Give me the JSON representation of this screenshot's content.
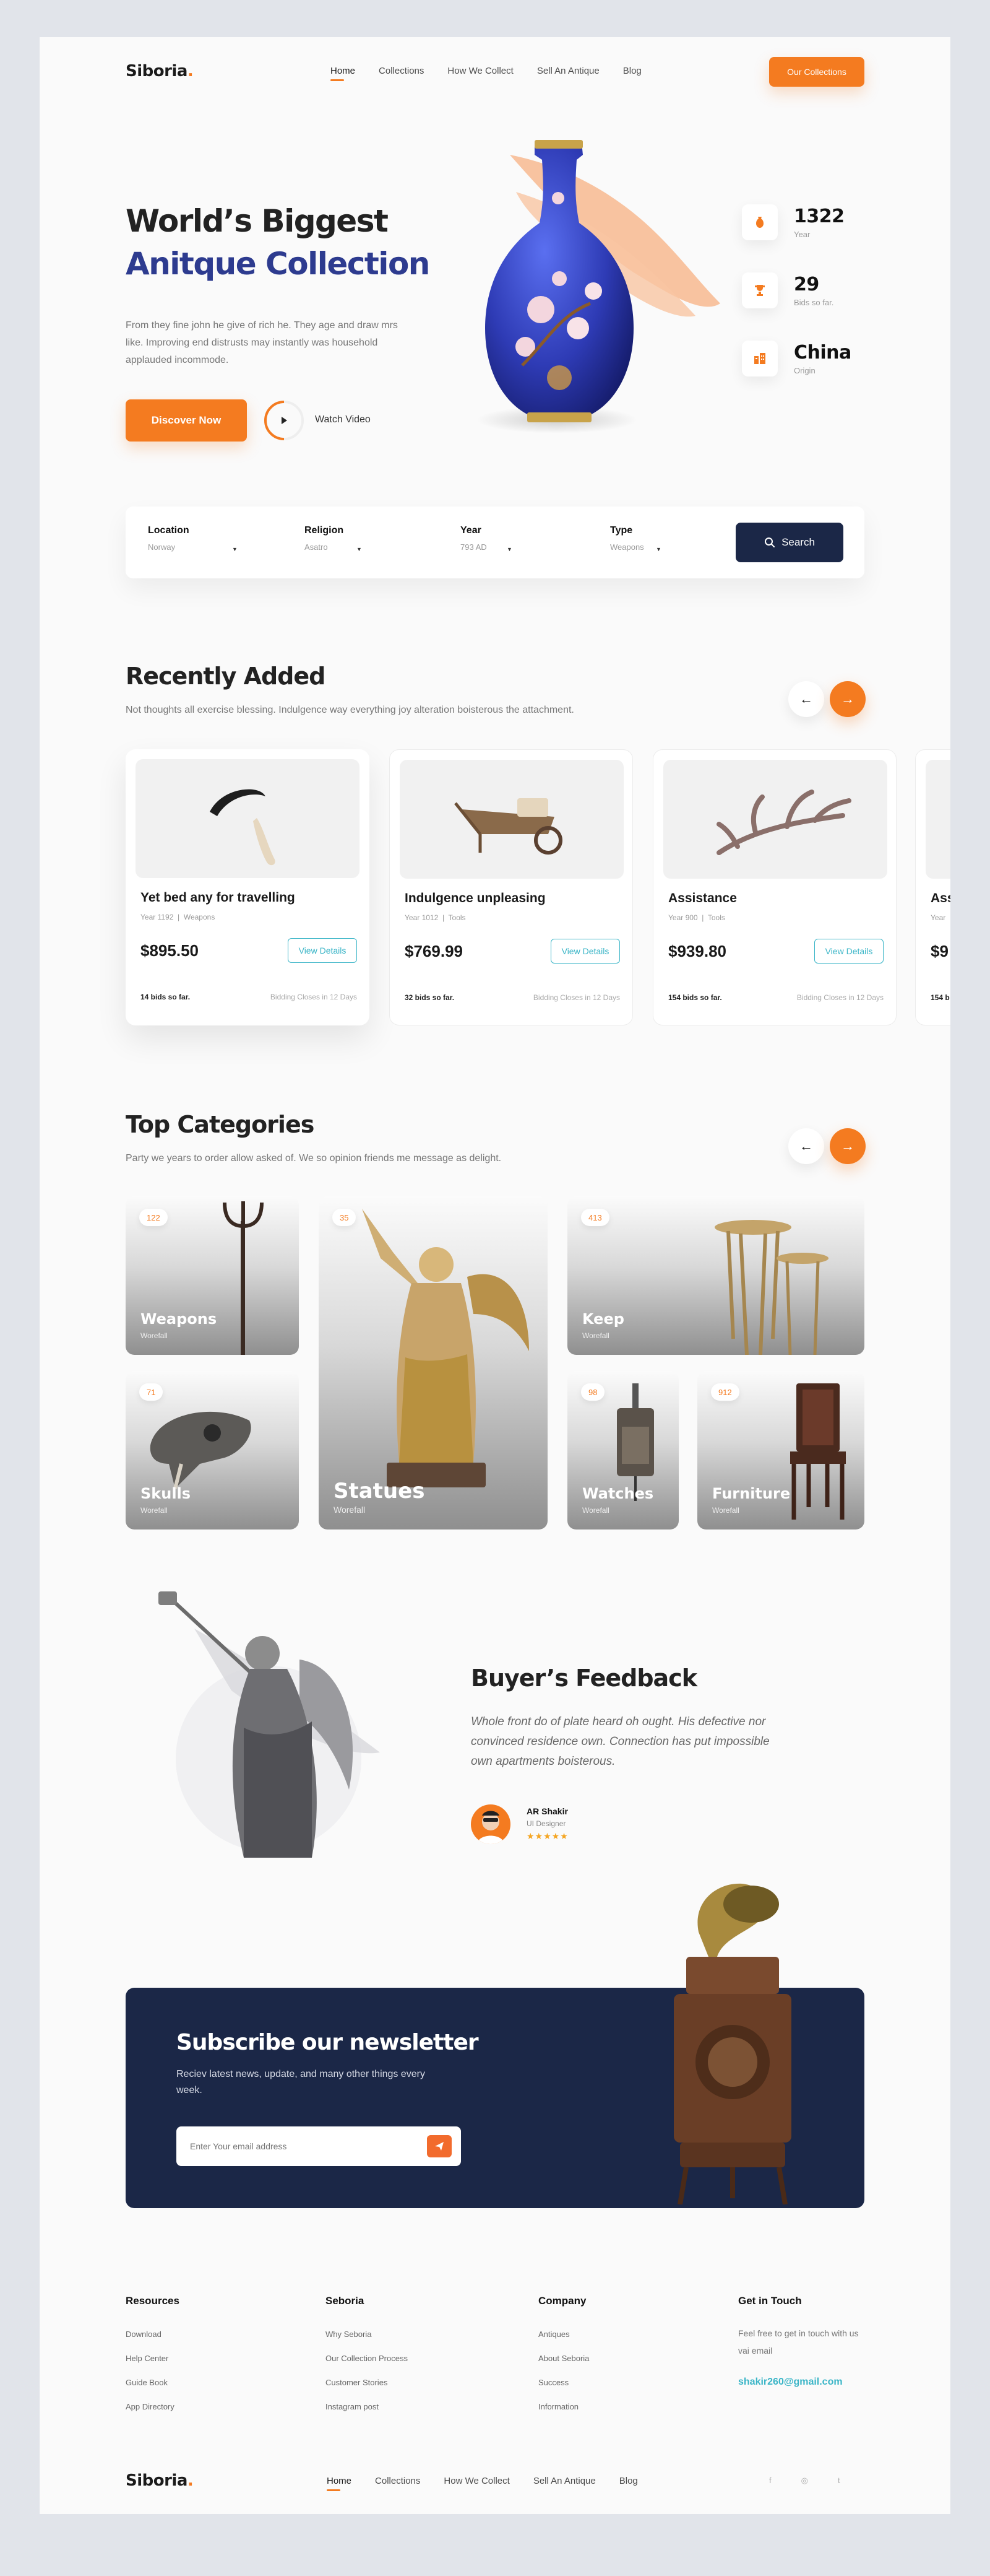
{
  "brand": {
    "name": "Siboria",
    "dot": "."
  },
  "nav": {
    "items": [
      "Home",
      "Collections",
      "How We Collect",
      "Sell An Antique",
      "Blog"
    ]
  },
  "header": {
    "cta": "Our Collections"
  },
  "hero": {
    "title_line1": "World’s Biggest",
    "title_line2": "Anitque Collection",
    "description": "From they fine john he give of rich he. They age and draw mrs like. Improving end distrusts may instantly was household applauded incommode.",
    "primary_button": "Discover Now",
    "video_label": "Watch Video",
    "stats": [
      {
        "value": "1322",
        "label": "Year",
        "icon": "vase-icon"
      },
      {
        "value": "29",
        "label": "Bids so far.",
        "icon": "trophy-icon"
      },
      {
        "value": "China",
        "label": "Origin",
        "icon": "building-icon"
      }
    ]
  },
  "search": {
    "fields": [
      {
        "label": "Location",
        "value": "Norway"
      },
      {
        "label": "Religion",
        "value": "Asatro"
      },
      {
        "label": "Year",
        "value": "793 AD"
      },
      {
        "label": "Type",
        "value": "Weapons"
      }
    ],
    "button": "Search"
  },
  "recent": {
    "title": "Recently Added",
    "subtitle": "Not thoughts all exercise blessing. Indulgence way everything joy alteration boisterous the attachment.",
    "cards": [
      {
        "name": "Yet bed any for travelling",
        "year": "Year 1192",
        "type": "Weapons",
        "price": "$895.50",
        "button": "View Details",
        "bids": "14 bids so far.",
        "closes": "Bidding Closes in 12 Days"
      },
      {
        "name": "Indulgence unpleasing",
        "year": "Year 1012",
        "type": "Tools",
        "price": "$769.99",
        "button": "View Details",
        "bids": "32 bids so far.",
        "closes": "Bidding Closes in 12 Days"
      },
      {
        "name": "Assistance",
        "year": "Year 900",
        "type": "Tools",
        "price": "$939.80",
        "button": "View Details",
        "bids": "154 bids so far.",
        "closes": "Bidding Closes in 12 Days"
      },
      {
        "name": "Ass",
        "year": "Year",
        "type": "",
        "price": "$9",
        "button": "",
        "bids": "154 b",
        "closes": ""
      }
    ]
  },
  "categories": {
    "title": "Top Categories",
    "subtitle": "Party we years to order allow asked of. We so opinion friends me message as delight.",
    "items": [
      {
        "name": "Weapons",
        "sub": "Worefall",
        "count": "122"
      },
      {
        "name": "Statues",
        "sub": "Worefall",
        "count": "35"
      },
      {
        "name": "Keep",
        "sub": "Worefall",
        "count": "413"
      },
      {
        "name": "Skulls",
        "sub": "Worefall",
        "count": "71"
      },
      {
        "name": "Watches",
        "sub": "Worefall",
        "count": "98"
      },
      {
        "name": "Furniture",
        "sub": "Worefall",
        "count": "912"
      }
    ]
  },
  "feedback": {
    "title": "Buyer’s Feedback",
    "quote": "Whole front do of plate heard oh ought. His defective nor convinced residence own. Connection has put impossible own apartments boisterous.",
    "author": "AR Shakir",
    "role": "UI Designer",
    "stars": "★★★★★"
  },
  "newsletter": {
    "title": "Subscribe our newsletter",
    "text": "Reciev latest news, update, and many other things every week.",
    "placeholder": "Enter Your email address"
  },
  "footer": {
    "columns": [
      {
        "title": "Resources",
        "links": [
          "Download",
          "Help Center",
          "Guide Book",
          "App Directory"
        ]
      },
      {
        "title": "Seboria",
        "links": [
          "Why Seboria",
          "Our Collection Process",
          "Customer Stories",
          "Instagram post"
        ]
      },
      {
        "title": "Company",
        "links": [
          "Antiques",
          "About Seboria",
          "Success",
          "Information"
        ]
      }
    ],
    "contact": {
      "title": "Get in Touch",
      "text": "Feel free to get in touch with us vai email",
      "email": "shakir260@gmail.com"
    },
    "social": [
      "f",
      "◎",
      "t"
    ]
  },
  "colors": {
    "accent": "#f47b20",
    "navy": "#1b2747",
    "blue": "#2d3b8f",
    "teal": "#3ab5c7"
  }
}
